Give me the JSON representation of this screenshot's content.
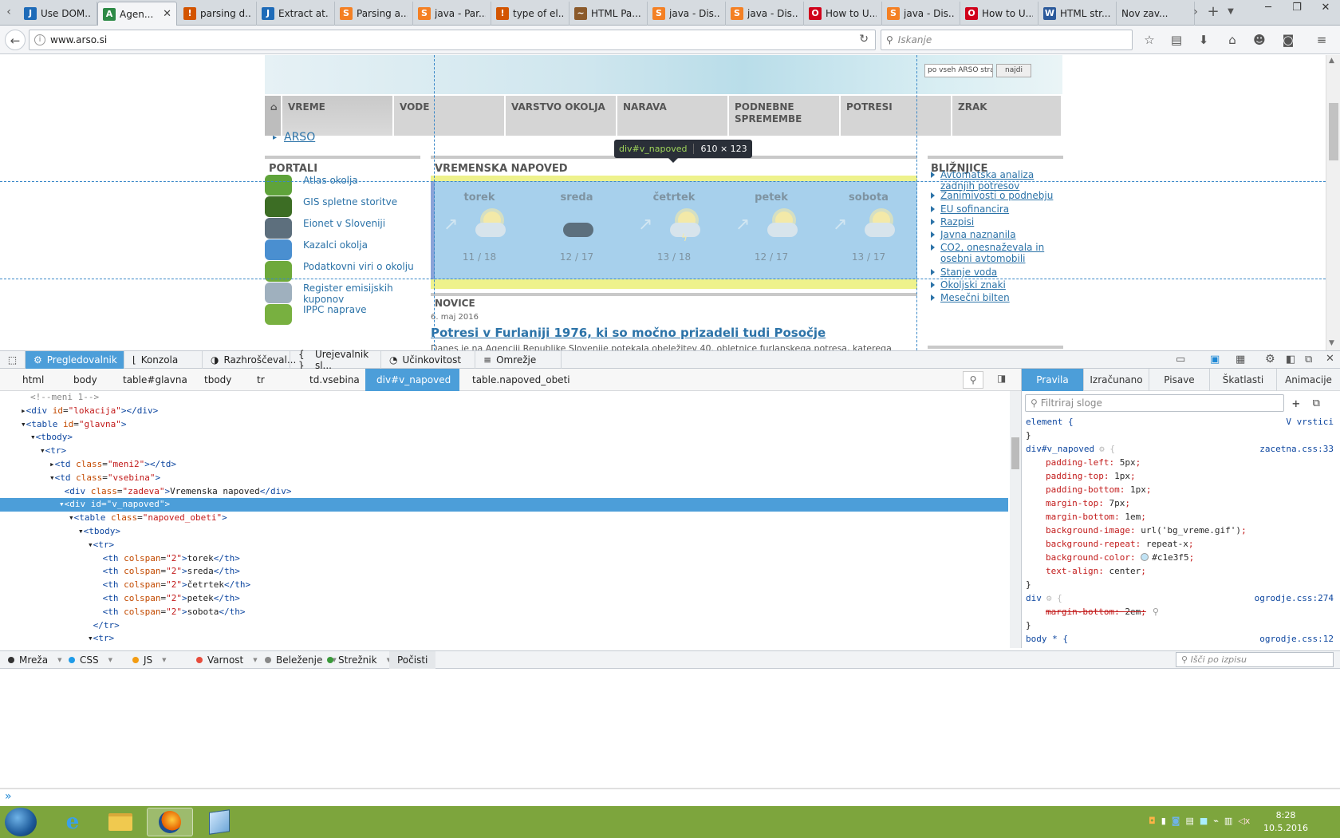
{
  "tabs": [
    {
      "label": "Use DOM...",
      "icon": "J",
      "color": "#1e6bb8"
    },
    {
      "label": "Agen...",
      "icon": "A",
      "color": "#2d8a46",
      "active": true
    },
    {
      "label": "parsing d...",
      "icon": "!",
      "color": "#d35400"
    },
    {
      "label": "Extract at...",
      "icon": "J",
      "color": "#1e6bb8"
    },
    {
      "label": "Parsing a...",
      "icon": "S",
      "color": "#f48024"
    },
    {
      "label": "java - Par...",
      "icon": "S",
      "color": "#f48024"
    },
    {
      "label": "type of el...",
      "icon": "!",
      "color": "#d35400"
    },
    {
      "label": "HTML Pa...",
      "icon": "~",
      "color": "#8b5a2b"
    },
    {
      "label": "java - Dis...",
      "icon": "S",
      "color": "#f48024"
    },
    {
      "label": "java - Dis...",
      "icon": "S",
      "color": "#f48024"
    },
    {
      "label": "How to U...",
      "icon": "O",
      "color": "#d0021b"
    },
    {
      "label": "java - Dis...",
      "icon": "S",
      "color": "#f48024"
    },
    {
      "label": "How to U...",
      "icon": "O",
      "color": "#d0021b"
    },
    {
      "label": "HTML str...",
      "icon": "W",
      "color": "#2c5a9b"
    },
    {
      "label": "Nov zav...",
      "icon": "",
      "color": "#999"
    }
  ],
  "url": "www.arso.si",
  "search_placeholder": "Iskanje",
  "site": {
    "search_placeholder": "po vseh ARSO strani",
    "search_button": "najdi",
    "menu": [
      "VREME",
      "VODE",
      "VARSTVO OKOLJA",
      "NARAVA",
      "PODNEBNE SPREMEMBE",
      "POTRESI",
      "ZRAK"
    ],
    "home_icon": "house-icon",
    "breadcrumb": "ARSO",
    "portals_title": "PORTALI",
    "portals": [
      "Atlas okolja",
      "GIS spletne storitve",
      "Eionet v Sloveniji",
      "Kazalci okolja",
      "Podatkovni viri o okolju",
      "Register emisijskih kuponov",
      "IPPC naprave"
    ],
    "forecast_title": "VREMENSKA NAPOVED",
    "forecast": [
      {
        "day": "torek",
        "temp": "11 / 18",
        "icon": "sun-cloud-icon",
        "wind": true
      },
      {
        "day": "sreda",
        "temp": "12 / 17",
        "icon": "cloud-icon",
        "wind": false
      },
      {
        "day": "četrtek",
        "temp": "13 / 18",
        "icon": "storm-icon",
        "wind": true
      },
      {
        "day": "petek",
        "temp": "12 / 17",
        "icon": "sun-cloud-icon",
        "wind": true
      },
      {
        "day": "sobota",
        "temp": "13 / 17",
        "icon": "sun-cloud-icon",
        "wind": true
      }
    ],
    "tooltip_name": "div#v_napoved",
    "tooltip_size": "610 × 123",
    "news_title": "NOVICE",
    "news_date": "6. maj 2016",
    "news_headline": "Potresi v Furlaniji 1976, ki so močno prizadeli tudi Posočje",
    "news_text": "Danes je na Agenciji Republike Slovenije potekala obeležitev 40. obletnice furlanskega potresa, katerega",
    "shortcuts_title": "BLIŽNJICE",
    "shortcuts": [
      "Avtomatska analiza zadnjih potresov",
      "Zanimivosti o podnebju",
      "EU sofinancira",
      "Razpisi",
      "Javna naznanila",
      "CO2, onesnaževala in osebni avtomobili",
      "Stanje voda",
      "Okoljski znaki",
      "Mesečni bilten"
    ]
  },
  "devtools": {
    "tools": [
      "Pregledovalnik",
      "Konzola",
      "Razhroščeval...",
      "Urejevalnik sl...",
      "Učinkovitost",
      "Omrežje"
    ],
    "breadcrumbs": [
      "html",
      "body",
      "table#glavna",
      "tbody",
      "tr",
      "td.vsebina",
      "div#v_napoved",
      "table.napoved_obeti"
    ],
    "rule_tabs": [
      "Pravila",
      "Izračunano",
      "Pisave",
      "Škatlasti model",
      "Animacije"
    ],
    "filter_placeholder": "Filtriraj sloge",
    "element_rule": {
      "selector": "element {",
      "source": "V vrstici"
    },
    "vnapoved_rule": {
      "selector": "div#v_napoved",
      "source": "zacetna.css:33",
      "props": [
        [
          "padding-left",
          "5px"
        ],
        [
          "padding-top",
          "1px"
        ],
        [
          "padding-bottom",
          "1px"
        ],
        [
          "margin-top",
          "7px"
        ],
        [
          "margin-bottom",
          "1em"
        ],
        [
          "background-image",
          "url('bg_vreme.gif')"
        ],
        [
          "background-repeat",
          "repeat-x"
        ],
        [
          "background-color",
          "#c1e3f5"
        ],
        [
          "text-align",
          "center"
        ]
      ]
    },
    "div_rule": {
      "selector": "div",
      "source": "ogrodje.css:274",
      "prop": "margin-bottom",
      "value": "2em"
    },
    "body_rule": {
      "selector": "body * {",
      "source": "ogrodje.css:12"
    },
    "console_filters": [
      {
        "label": "Mreža",
        "color": "#333"
      },
      {
        "label": "CSS",
        "color": "#1e9be8"
      },
      {
        "label": "JS",
        "color": "#f39c12"
      },
      {
        "label": "Varnost",
        "color": "#e74c3c"
      },
      {
        "label": "Beleženje",
        "color": "#888"
      },
      {
        "label": "Strežnik",
        "color": "#3a9a3a"
      }
    ],
    "clear_label": "Počisti",
    "console_search_placeholder": "Išči po izpisu",
    "console_prompt": "»"
  },
  "clock": {
    "time": "8:28",
    "date": "10.5.2016"
  }
}
